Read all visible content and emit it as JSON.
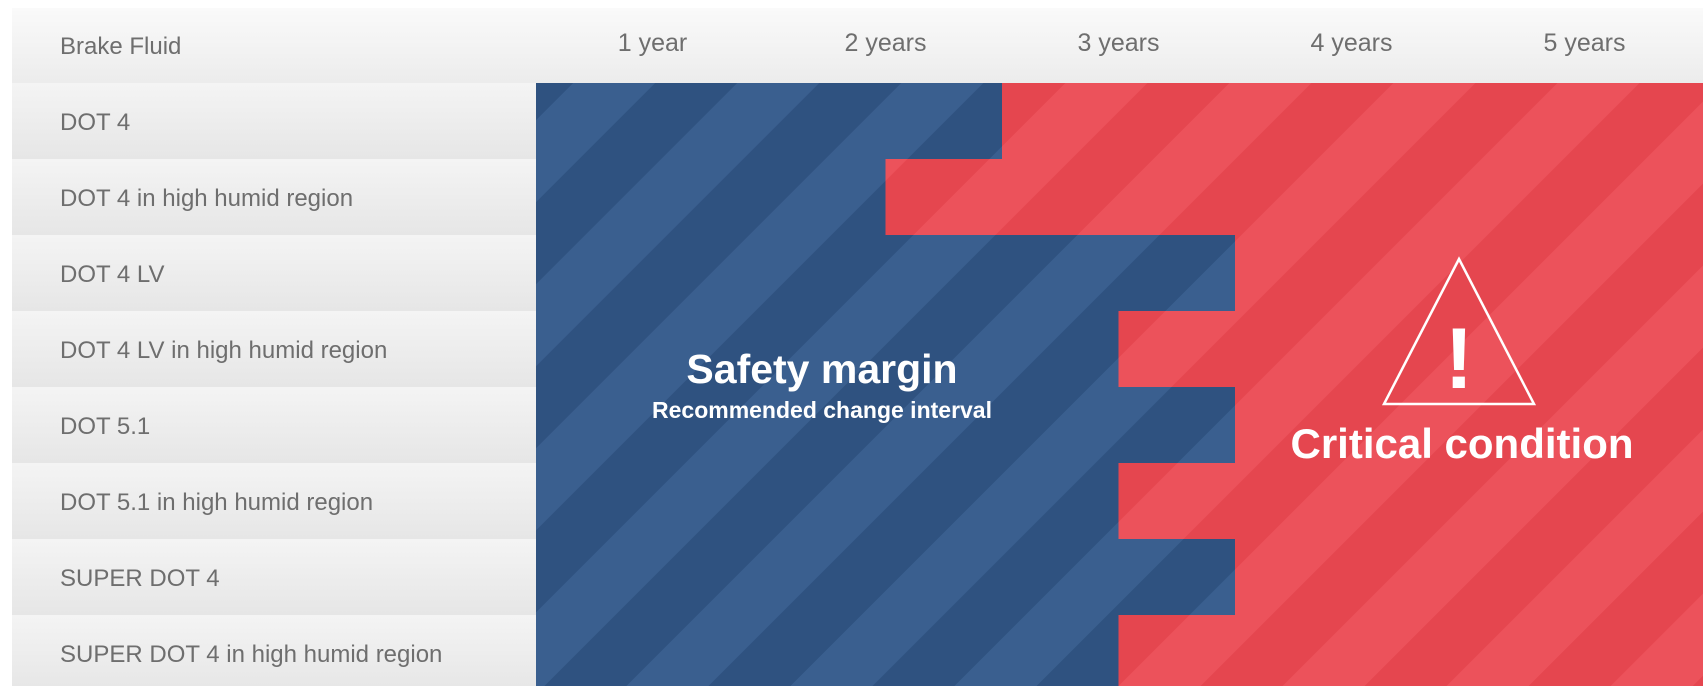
{
  "chart_data": {
    "type": "bar",
    "orientation": "horizontal",
    "stacked": true,
    "row_header": "Brake Fluid",
    "x_unit": "years",
    "xlim": [
      0,
      5
    ],
    "x_tick_labels": [
      "1 year",
      "2 years",
      "3 years",
      "4 years",
      "5 years"
    ],
    "categories": [
      "DOT 4",
      "DOT 4 in high humid region",
      "DOT 4 LV",
      "DOT 4 LV in high humid region",
      "DOT 5.1",
      "DOT 5.1 in high humid region",
      "SUPER DOT 4",
      "SUPER DOT 4 in high humid region"
    ],
    "series": [
      {
        "name": "Safety margin",
        "values": [
          2,
          1.5,
          3,
          2.5,
          3,
          2.5,
          3,
          2.5
        ]
      },
      {
        "name": "Critical condition",
        "values": [
          3,
          3.5,
          2,
          2.5,
          2,
          2.5,
          2,
          2.5
        ]
      }
    ],
    "annotations": {
      "safe_title": "Safety margin",
      "safe_subtitle": "Recommended change interval",
      "critical_title": "Critical condition",
      "warning_mark": "!"
    },
    "colors": {
      "safe": "#2f5280",
      "safe_stripe": "#3a5f8f",
      "critical": "#e5464f",
      "critical_stripe": "#ec525b",
      "label_band_light": "#f5f5f5",
      "label_band_dark": "#e8e8e8",
      "label_text": "#6e6e6e"
    }
  }
}
